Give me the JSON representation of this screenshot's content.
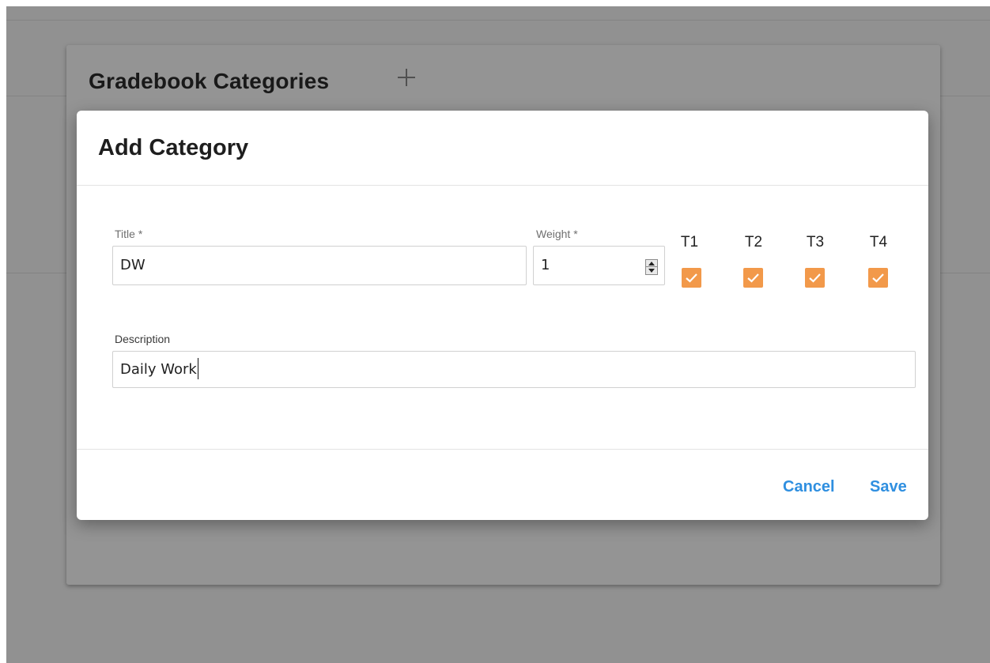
{
  "background": {
    "card_title": "Gradebook Categories",
    "add_icon": "plus-icon"
  },
  "dialog": {
    "title": "Add Category",
    "fields": {
      "title": {
        "label": "Title *",
        "value": "DW"
      },
      "weight": {
        "label": "Weight *",
        "value": "1"
      },
      "description": {
        "label": "Description",
        "value": "Daily Work"
      }
    },
    "terms": [
      {
        "label": "T1",
        "checked": true
      },
      {
        "label": "T2",
        "checked": true
      },
      {
        "label": "T3",
        "checked": true
      },
      {
        "label": "T4",
        "checked": true
      }
    ],
    "actions": {
      "cancel_label": "Cancel",
      "save_label": "Save"
    }
  },
  "colors": {
    "accent": "#2f8fe0",
    "checkbox": "#f2994a",
    "overlay": "rgba(0,0,0,0.42)"
  }
}
